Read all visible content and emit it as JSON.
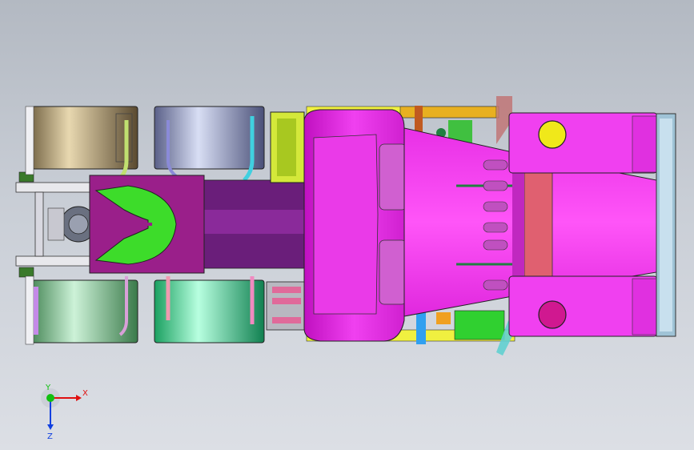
{
  "viewport": {
    "background_top": "#b3b9c2",
    "background_bottom": "#dcdfe5"
  },
  "model": {
    "description_icon": "truck-tractor-top-view",
    "colors": {
      "cab": "#e61ee6",
      "hood": "#f23cf0",
      "fifth_wheel_plate": "#3ddc2a",
      "fifth_wheel_base": "#9a1f8a",
      "frame": "#6a1e7a",
      "tire_rear_left_front": "#c9b48a",
      "tire_rear_left_back": "#aab2dd",
      "tire_rear_right_front": "#8fd6a4",
      "tire_rear_right_back": "#3de89a",
      "fuel_tank": "#d4e83a",
      "headlight": "#f0e81a",
      "bumper": "#9fc3d6"
    }
  },
  "triad": {
    "x_label": "X",
    "y_label": "Y",
    "z_label": "Z",
    "x_color": "#e01010",
    "y_color": "#10c010",
    "z_color": "#1040e0"
  }
}
